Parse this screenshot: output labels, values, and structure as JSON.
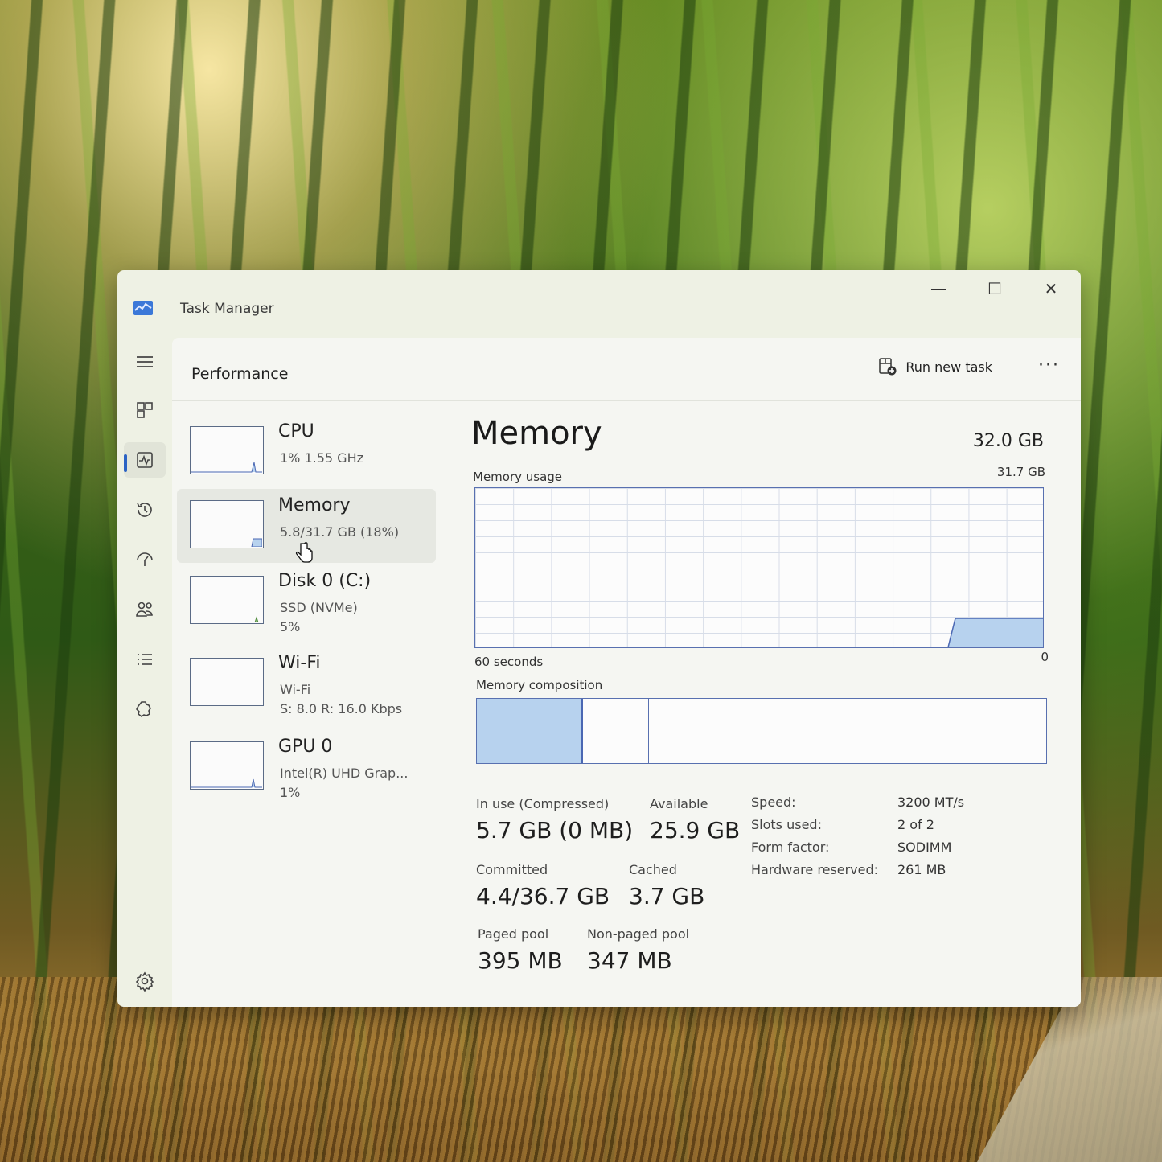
{
  "window": {
    "title": "Task Manager"
  },
  "header": {
    "page_title": "Performance",
    "run_new_task": "Run new task",
    "more": "···"
  },
  "nav": [
    {
      "name": "hamburger-menu-icon"
    },
    {
      "name": "processes-icon"
    },
    {
      "name": "performance-icon",
      "active": true
    },
    {
      "name": "app-history-icon"
    },
    {
      "name": "startup-apps-icon"
    },
    {
      "name": "users-icon"
    },
    {
      "name": "details-icon"
    },
    {
      "name": "services-icon"
    },
    {
      "name": "settings-icon"
    }
  ],
  "sidebar": {
    "items": [
      {
        "name": "CPU",
        "sub1": "1% 1.55 GHz",
        "sub2": ""
      },
      {
        "name": "Memory",
        "sub1": "5.8/31.7 GB (18%)",
        "sub2": "",
        "selected": true
      },
      {
        "name": "Disk 0 (C:)",
        "sub1": "SSD (NVMe)",
        "sub2": "5%"
      },
      {
        "name": "Wi-Fi",
        "sub1": "Wi-Fi",
        "sub2": "S: 8.0 R: 16.0 Kbps"
      },
      {
        "name": "GPU 0",
        "sub1": "Intel(R) UHD Grap...",
        "sub2": "1%"
      }
    ]
  },
  "main": {
    "title": "Memory",
    "total": "32.0 GB",
    "usage_label": "Memory usage",
    "usage_max": "31.7 GB",
    "axis_left": "60 seconds",
    "axis_right": "0",
    "composition_label": "Memory composition",
    "composition": {
      "in_use_fraction": 0.184,
      "modified_fraction": 0.115
    },
    "stats": {
      "in_use_label": "In use (Compressed)",
      "in_use": "5.7 GB (0 MB)",
      "available_label": "Available",
      "available": "25.9 GB",
      "committed_label": "Committed",
      "committed": "4.4/36.7 GB",
      "cached_label": "Cached",
      "cached": "3.7 GB",
      "paged_label": "Paged pool",
      "paged": "395 MB",
      "nonpaged_label": "Non-paged pool",
      "nonpaged": "347 MB"
    },
    "details": [
      {
        "label": "Speed:",
        "value": "3200 MT/s"
      },
      {
        "label": "Slots used:",
        "value": "2 of 2"
      },
      {
        "label": "Form factor:",
        "value": "SODIMM"
      },
      {
        "label": "Hardware reserved:",
        "value": "261 MB"
      }
    ]
  },
  "colors": {
    "accent": "#2b63c4",
    "graph_fill": "#b7d2ee",
    "graph_line": "#4a67b3"
  }
}
